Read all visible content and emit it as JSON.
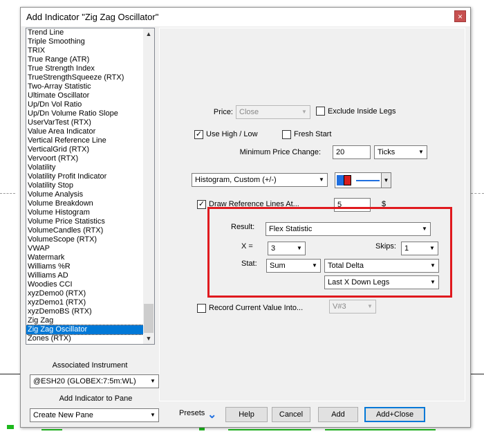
{
  "dialog": {
    "title": "Add Indicator \"Zig Zag Oscillator\"",
    "close_label": "×"
  },
  "indicator_list": {
    "items": [
      "Trend Line",
      "Triple Smoothing",
      "TRIX",
      "True Range (ATR)",
      "True Strength Index",
      "TrueStrengthSqueeze (RTX)",
      "Two-Array Statistic",
      "Ultimate Oscillator",
      "Up/Dn Vol Ratio",
      "Up/Dn Volume Ratio Slope",
      "UserVarTest (RTX)",
      "Value Area Indicator",
      "Vertical Reference Line",
      "VerticalGrid (RTX)",
      "Vervoort (RTX)",
      "Volatility",
      "Volatility Profit Indicator",
      "Volatility Stop",
      "Volume Analysis",
      "Volume Breakdown",
      "Volume Histogram",
      "Volume Price Statistics",
      "VolumeCandles (RTX)",
      "VolumeScope (RTX)",
      "VWAP",
      "Watermark",
      "Williams %R",
      "Williams AD",
      "Woodies CCI",
      "xyzDemo0 (RTX)",
      "xyzDemo1 (RTX)",
      "xyzDemoBS (RTX)",
      "Zig Zag",
      "Zig Zag Oscillator",
      "Zones (RTX)"
    ],
    "selected_index": 33,
    "scroll_up": "▲",
    "scroll_down": "▼"
  },
  "associated_instrument": {
    "label": "Associated Instrument",
    "value": "@ESH20 (GLOBEX:7:5m:WL)"
  },
  "add_to_pane": {
    "label": "Add Indicator to Pane",
    "value": "Create New Pane"
  },
  "settings": {
    "price_label": "Price:",
    "price_value": "Close",
    "exclude_inside_legs_label": "Exclude Inside Legs",
    "exclude_inside_legs_checked": "",
    "use_high_low_label": "Use High / Low",
    "use_high_low_checked": "✓",
    "fresh_start_label": "Fresh Start",
    "fresh_start_checked": "",
    "min_price_change_label": "Minimum Price Change:",
    "min_price_change_value": "20",
    "min_price_change_unit": "Ticks",
    "plot_style": "Histogram, Custom (+/-)",
    "color_up": "#1f6fe0",
    "color_down": "#d81e1e",
    "line_color": "#1f6fe0",
    "draw_ref_lines_label": "Draw Reference Lines At...",
    "draw_ref_lines_checked": "✓",
    "ref_lines_value": "5",
    "ref_lines_dollar": "$",
    "result_label": "Result:",
    "result_value": "Flex Statistic",
    "x_label": "X =",
    "x_value": "3",
    "skips_label": "Skips:",
    "skips_value": "1",
    "stat_label": "Stat:",
    "stat_value": "Sum",
    "stat_field": "Total Delta",
    "stat_legs": "Last X Down Legs",
    "record_label": "Record Current Value Into...",
    "record_checked": "",
    "record_value": "V#3"
  },
  "buttons": {
    "presets": "Presets",
    "presets_icon": "⌄",
    "help": "Help",
    "cancel": "Cancel",
    "add": "Add",
    "add_close": "Add+Close"
  },
  "dropdown_arrow": "▼"
}
